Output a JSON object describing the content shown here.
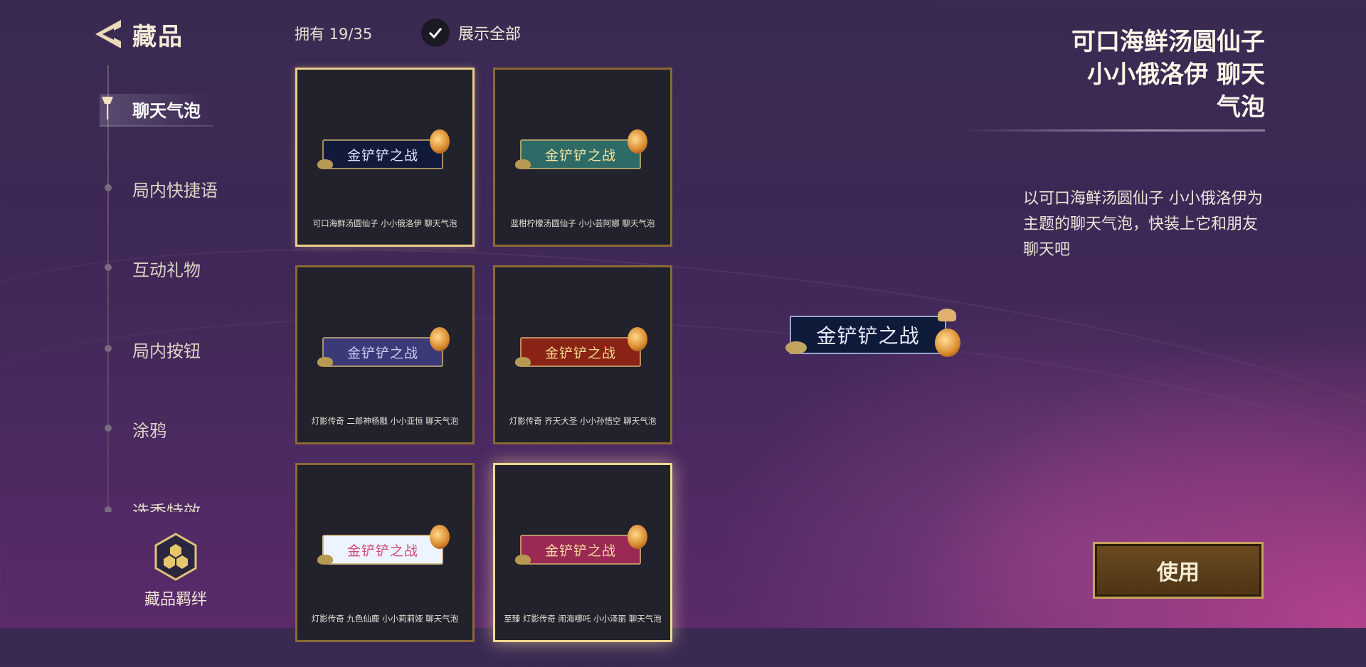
{
  "header": {
    "title": "藏品"
  },
  "sidebar": {
    "items": [
      {
        "label": "聊天气泡",
        "active": true
      },
      {
        "label": "局内快捷语"
      },
      {
        "label": "互动礼物"
      },
      {
        "label": "局内按钮"
      },
      {
        "label": "涂鸦"
      },
      {
        "label": "选秀特效"
      }
    ],
    "bond_label": "藏品羁绊"
  },
  "toolbar": {
    "owned_label": "拥有 19/35",
    "show_all_label": "展示全部",
    "show_all_checked": true
  },
  "cards": [
    {
      "bubble_text": "金铲铲之战",
      "name": "可口海鲜汤圆仙子  小小俄洛伊    聊天气泡",
      "bubble_color": "#121a3c",
      "bubble_text_color": "#dfe6ff",
      "state": "selected"
    },
    {
      "bubble_text": "金铲铲之战",
      "name": "蓝柑柠檬汤圆仙子  小小芸阿娜  聊天气泡",
      "bubble_color": "#2e6b66",
      "bubble_text_color": "#f4e4a4",
      "state": "normal"
    },
    {
      "bubble_text": "金铲铲之战",
      "name": "灯影传奇  二郎神杨戬  小小亚恒  聊天气泡",
      "bubble_color": "#3b3a78",
      "bubble_text_color": "#c9cdf4",
      "state": "normal"
    },
    {
      "bubble_text": "金铲铲之战",
      "name": "灯影传奇  齐天大圣  小小孙悟空  聊天气泡",
      "bubble_color": "#8a2216",
      "bubble_text_color": "#f3d88a",
      "state": "normal"
    },
    {
      "bubble_text": "金铲铲之战",
      "name": "灯影传奇  九色仙鹿  小小莉莉娅  聊天气泡",
      "bubble_color": "#eef4ff",
      "bubble_text_color": "#d24a7a",
      "state": "normal"
    },
    {
      "bubble_text": "金铲铲之战",
      "name": "至臻  灯影传奇  闹海哪吒  小小泽丽  聊天气泡",
      "bubble_color": "#9a2a54",
      "bubble_text_color": "#f6d6a0",
      "state": "glow"
    }
  ],
  "detail": {
    "title_line1": "可口海鲜汤圆仙子",
    "title_line2": "小小俄洛伊    聊天",
    "title_line3": "气泡",
    "description": "以可口海鲜汤圆仙子 小小俄洛伊为主题的聊天气泡，快装上它和朋友聊天吧",
    "preview_text": "金铲铲之战",
    "use_button_label": "使用"
  },
  "colors": {
    "accent_gold": "#c9a25a",
    "card_bg": "#22222c",
    "card_border": "#8a6a34"
  }
}
